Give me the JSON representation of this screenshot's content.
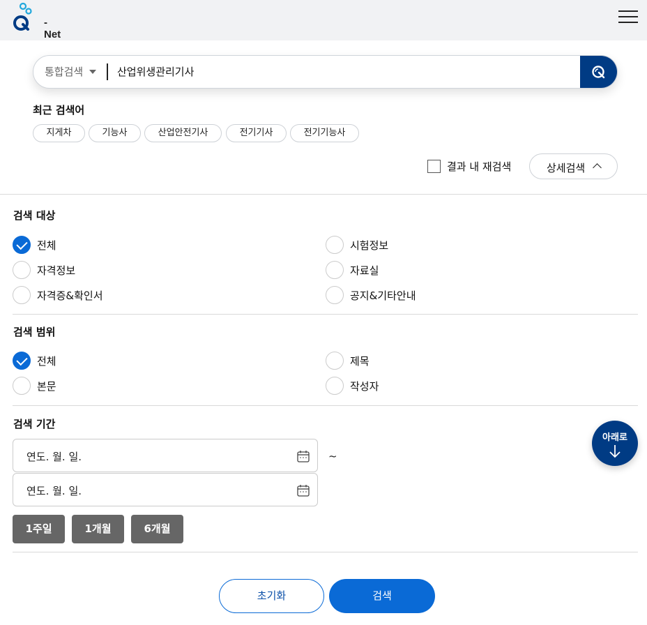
{
  "header": {
    "logo_text": "Q-Net",
    "logo_dash_text": "- Net"
  },
  "search": {
    "scope_label": "통합검색",
    "query": "산업위생관리기사",
    "recent_title": "최근 검색어",
    "recent_keywords": [
      "지게차",
      "기능사",
      "산업안전기사",
      "전기기사",
      "전기기능사"
    ],
    "rescan_label": "결과 내 재검색",
    "detail_label": "상세검색"
  },
  "target": {
    "title": "검색 대상",
    "options": [
      {
        "label": "전체",
        "checked": true
      },
      {
        "label": "시험정보",
        "checked": false
      },
      {
        "label": "자격정보",
        "checked": false
      },
      {
        "label": "자료실",
        "checked": false
      },
      {
        "label": "자격증&확인서",
        "checked": false
      },
      {
        "label": "공지&기타안내",
        "checked": false
      }
    ]
  },
  "range": {
    "title": "검색 범위",
    "options": [
      {
        "label": "전체",
        "checked": true
      },
      {
        "label": "제목",
        "checked": false
      },
      {
        "label": "본문",
        "checked": false
      },
      {
        "label": "작성자",
        "checked": false
      }
    ]
  },
  "period": {
    "title": "검색 기간",
    "start_placeholder": "연도. 월. 일.",
    "end_placeholder": "연도. 월. 일.",
    "separator": "~",
    "buttons": [
      "1주일",
      "1개월",
      "6개월"
    ]
  },
  "floating": {
    "label": "아래로"
  },
  "actions": {
    "reset": "초기화",
    "search": "검색"
  },
  "colors": {
    "primary_navy": "#003b84",
    "accent_blue": "#0a6ad6",
    "period_button_gray": "#666666",
    "topbar_bg": "#f1f2f4"
  },
  "icons": [
    "hamburger-menu-icon",
    "magnifier-icon",
    "caret-down-icon",
    "chevron-up-icon",
    "calendar-icon",
    "arrow-down-icon",
    "check-icon"
  ]
}
